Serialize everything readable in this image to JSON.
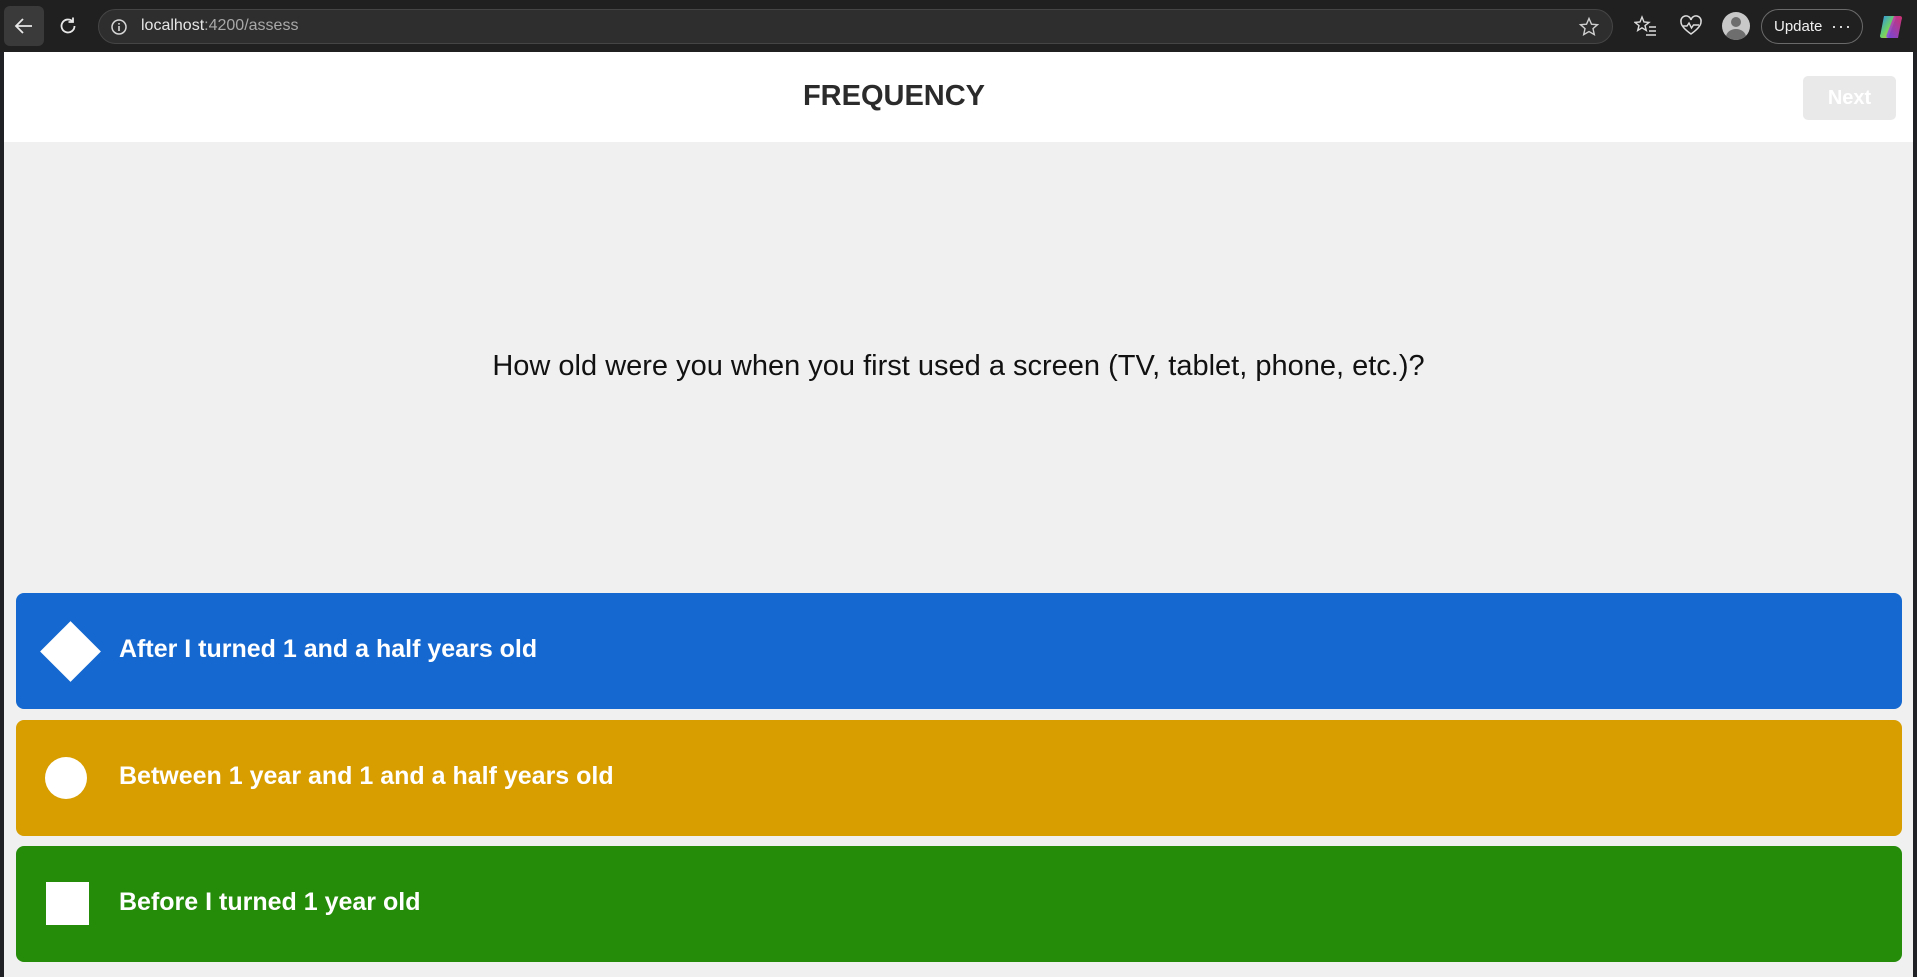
{
  "browser": {
    "url_host": "localhost",
    "url_path": ":4200/assess",
    "update_label": "Update",
    "more_label": "···"
  },
  "header": {
    "title": "FREQUENCY",
    "next_label": "Next"
  },
  "question": {
    "text": "How old were you when you first used a screen (TV, tablet, phone, etc.)?"
  },
  "answers": [
    {
      "label": "After I turned 1 and a half years old",
      "shape": "diamond",
      "color": "#1468cf"
    },
    {
      "label": "Between 1 year and 1 and a half years old",
      "shape": "circle",
      "color": "#d89e00"
    },
    {
      "label": "Before I turned 1 year old",
      "shape": "square",
      "color": "#258c0a"
    }
  ]
}
